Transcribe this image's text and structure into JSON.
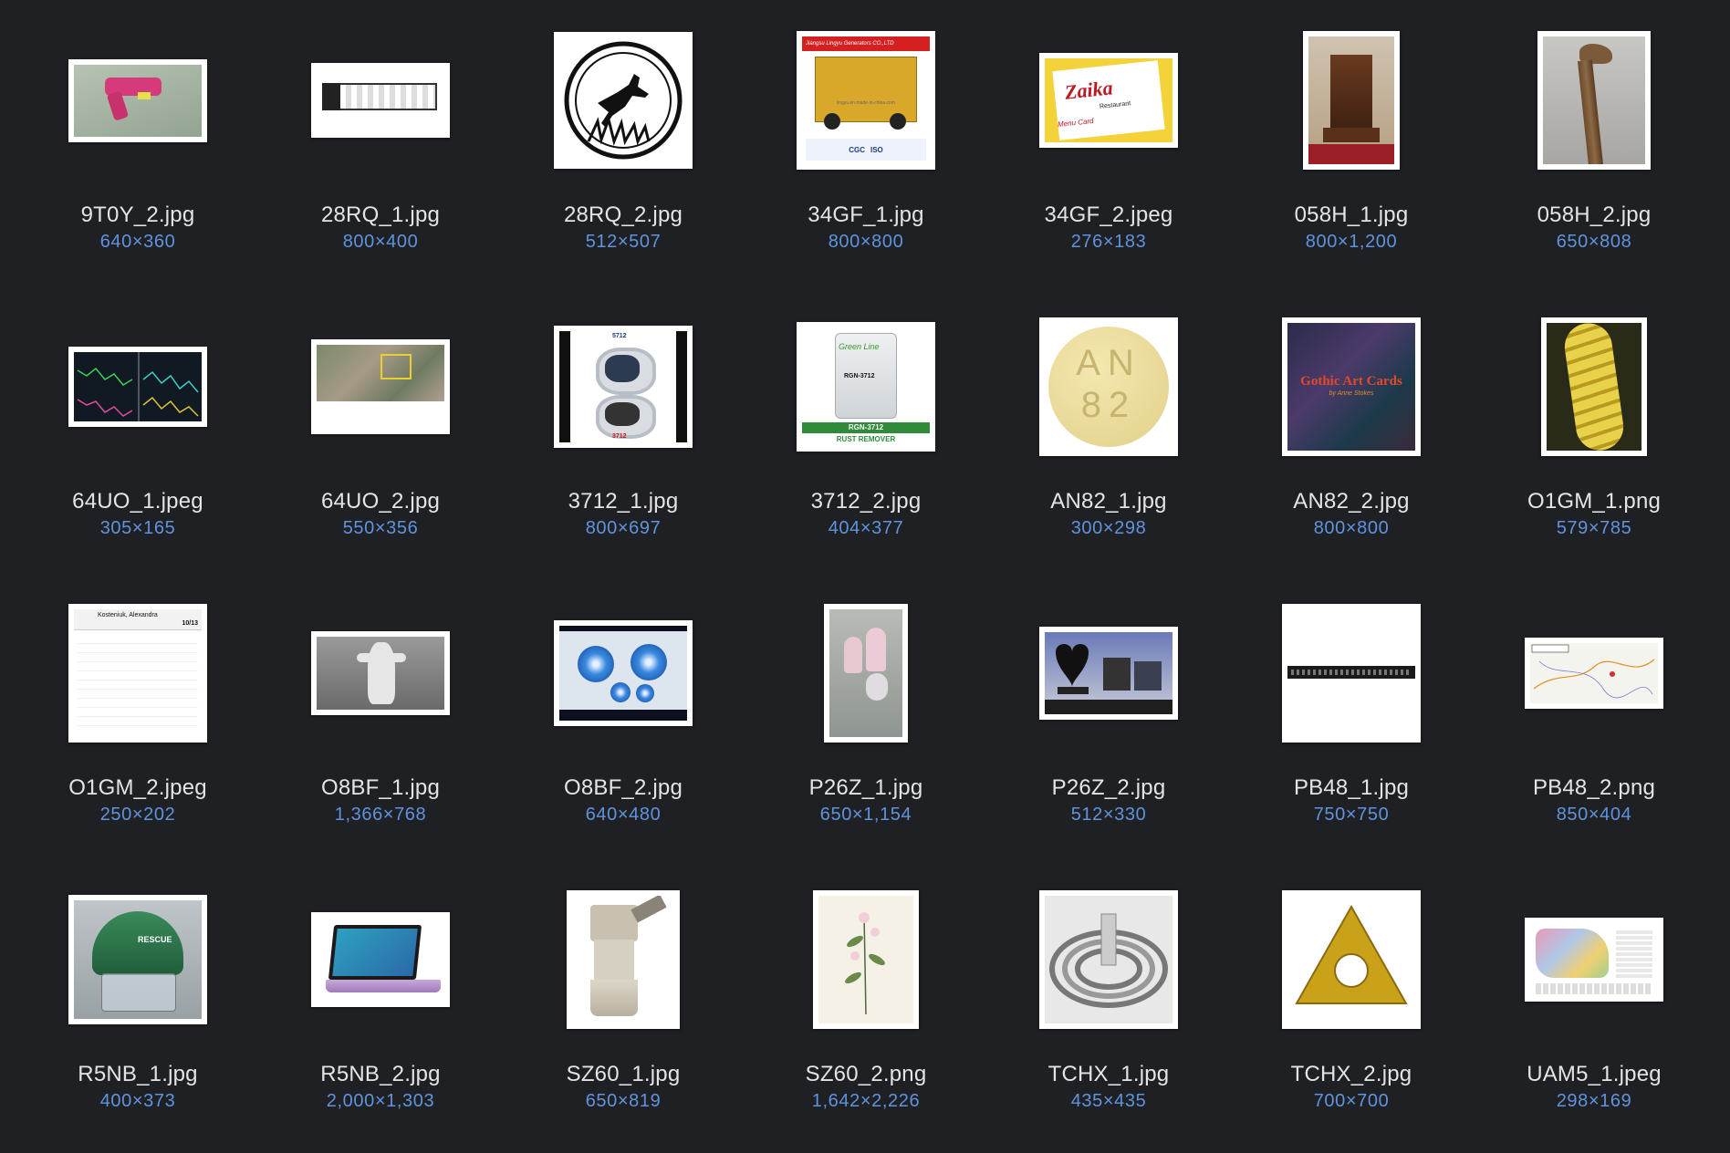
{
  "colors": {
    "background": "#1f2024",
    "filename": "#e4e4e6",
    "dimensions": "#5f93dd"
  },
  "files": [
    {
      "name": "9T0Y_2.jpg",
      "dims": "640×360",
      "icon": "toy-gun-thumbnail"
    },
    {
      "name": "28RQ_1.jpg",
      "dims": "800×400",
      "icon": "trailer-floorplan-thumbnail"
    },
    {
      "name": "28RQ_2.jpg",
      "dims": "512×507",
      "icon": "deer-emblem-thumbnail"
    },
    {
      "name": "34GF_1.jpg",
      "dims": "800×800",
      "icon": "generator-thumbnail",
      "text": [
        "Jiangsu Lingyu Generators CO.,LTD",
        "lingyu.en.made-in-china.com",
        "CGC",
        "ISO"
      ]
    },
    {
      "name": "34GF_2.jpeg",
      "dims": "276×183",
      "icon": "menu-card-thumbnail",
      "text": [
        "Zaika",
        "Restaurant",
        "Menu Card"
      ]
    },
    {
      "name": "058H_1.jpg",
      "dims": "800×1,200",
      "icon": "antique-clock-thumbnail"
    },
    {
      "name": "058H_2.jpg",
      "dims": "650×808",
      "icon": "carved-staff-thumbnail"
    },
    {
      "name": "64UO_1.jpeg",
      "dims": "305×165",
      "icon": "stock-chart-thumbnail"
    },
    {
      "name": "64UO_2.jpg",
      "dims": "550×356",
      "icon": "aerial-map-thumbnail"
    },
    {
      "name": "3712_1.jpg",
      "dims": "800×697",
      "icon": "watch-thumbnail",
      "text": [
        "5712",
        "3712"
      ]
    },
    {
      "name": "3712_2.jpg",
      "dims": "404×377",
      "icon": "rust-remover-can-thumbnail",
      "text": [
        "Green Line",
        "RGN-3712",
        "RUST REMOVER"
      ]
    },
    {
      "name": "AN82_1.jpg",
      "dims": "300×298",
      "icon": "pill-thumbnail",
      "text": [
        "AN",
        "82"
      ]
    },
    {
      "name": "AN82_2.jpg",
      "dims": "800×800",
      "icon": "gothic-cards-thumbnail",
      "text": [
        "Gothic Art Cards",
        "by Anne Stokes"
      ]
    },
    {
      "name": "O1GM_1.png",
      "dims": "579×785",
      "icon": "caterpillar-thumbnail"
    },
    {
      "name": "O1GM_2.jpeg",
      "dims": "250×202",
      "icon": "chess-table-thumbnail",
      "text": [
        "Kosteniuk, Alexandra",
        "10/13"
      ]
    },
    {
      "name": "O8BF_1.jpg",
      "dims": "1,366×768",
      "icon": "statue-thumbnail"
    },
    {
      "name": "O8BF_2.jpg",
      "dims": "640×480",
      "icon": "ribbon-flowers-thumbnail"
    },
    {
      "name": "P26Z_1.jpg",
      "dims": "650×1,154",
      "icon": "nail-art-thumbnail"
    },
    {
      "name": "P26Z_2.jpg",
      "dims": "512×330",
      "icon": "headstones-thumbnail"
    },
    {
      "name": "PB48_1.jpg",
      "dims": "750×750",
      "icon": "patch-panel-thumbnail"
    },
    {
      "name": "PB48_2.png",
      "dims": "850×404",
      "icon": "location-map-thumbnail"
    },
    {
      "name": "R5NB_1.jpg",
      "dims": "400×373",
      "icon": "rescue-helmet-thumbnail",
      "text": [
        "RESCUE"
      ]
    },
    {
      "name": "R5NB_2.jpg",
      "dims": "2,000×1,303",
      "icon": "laptop-thumbnail"
    },
    {
      "name": "SZ60_1.jpg",
      "dims": "650×819",
      "icon": "microscope-thumbnail"
    },
    {
      "name": "SZ60_2.png",
      "dims": "1,642×2,226",
      "icon": "botanical-thumbnail"
    },
    {
      "name": "TCHX_1.jpg",
      "dims": "435×435",
      "icon": "coil-thumbnail"
    },
    {
      "name": "TCHX_2.jpg",
      "dims": "700×700",
      "icon": "insert-thumbnail"
    },
    {
      "name": "UAM5_1.jpeg",
      "dims": "298×169",
      "icon": "district-map-thumbnail"
    }
  ]
}
